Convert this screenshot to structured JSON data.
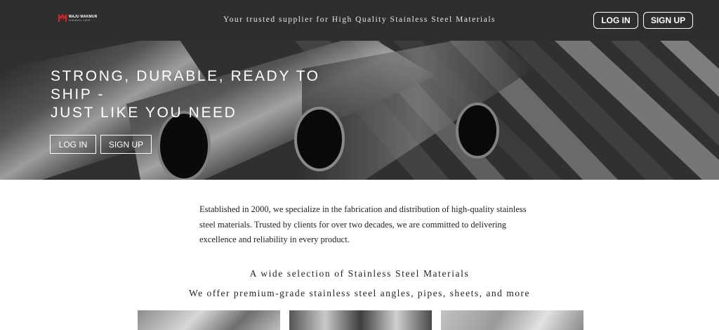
{
  "header": {
    "logo_name": "MAJU MAKMUR",
    "logo_sub": "stainless steel",
    "tagline": "Your trusted supplier for High Quality Stainless Steel Materials",
    "login_label": "LOG IN",
    "signup_label": "SIGN UP"
  },
  "hero": {
    "title_line1": "STRONG, DURABLE, READY TO",
    "title_line2": "SHIP -",
    "title_line3": "JUST LIKE YOU NEED",
    "login_label": "LOG IN",
    "signup_label": "SIGN UP"
  },
  "about": {
    "text": "Established in 2000, we specialize in the fabrication and distribution of high-quality stainless steel materials. Trusted by clients for over two decades, we are committed to delivering excellence and reliability in every product."
  },
  "products": {
    "title": "A wide selection of Stainless Steel Materials",
    "subtitle": "We offer premium-grade stainless steel angles, pipes, sheets, and more"
  },
  "colors": {
    "header_bg": "#2e2e2e",
    "logo_accent": "#d9252a",
    "text_dark": "#222222"
  }
}
